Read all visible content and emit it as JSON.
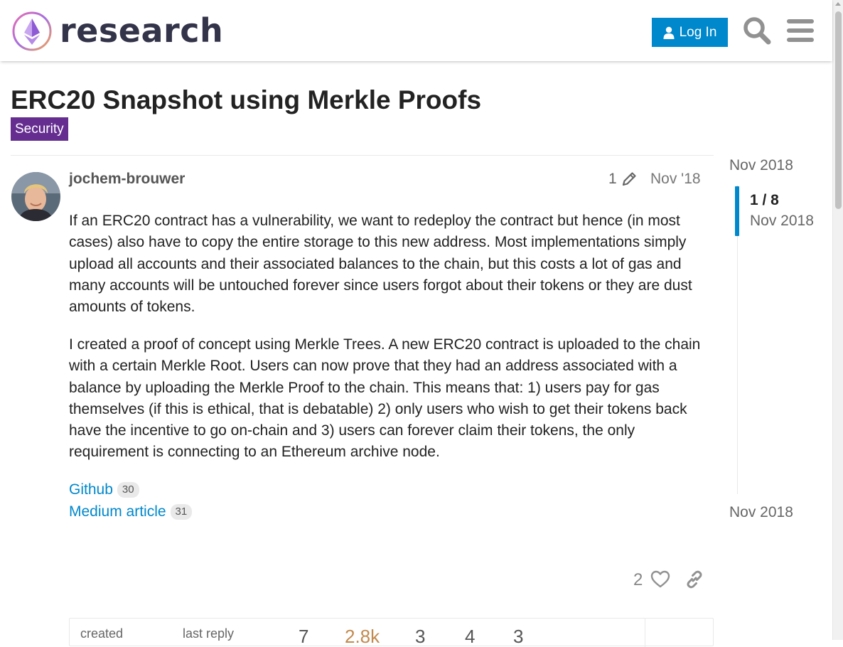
{
  "header": {
    "site_name": "research",
    "login_label": "Log In",
    "search_icon": "search-icon",
    "menu_icon": "hamburger-menu-icon",
    "brand_color": "#0088cc"
  },
  "topic": {
    "title": "ERC20 Snapshot using Merkle Proofs",
    "category": "Security",
    "category_color": "#652d90"
  },
  "post": {
    "username": "jochem-brouwer",
    "edit_count": "1",
    "date": "Nov '18",
    "paragraphs": [
      "If an ERC20 contract has a vulnerability, we want to redeploy the contract but hence (in most cases) also have to copy the entire storage to this new address. Most implementations simply upload all accounts and their associated balances to the chain, but this costs a lot of gas and many accounts will be untouched forever since users forgot about their tokens or they are dust amounts of tokens.",
      "I created a proof of concept using Merkle Trees. A new ERC20 contract is uploaded to the chain with a certain Merkle Root. Users can now prove that they had an address associated with a balance by uploading the Merkle Proof to the chain. This means that: 1) users pay for gas themselves (if this is ethical, that is debatable) 2) only users who wish to get their tokens back have the incentive to go on-chain and 3) users can forever claim their tokens, the only requirement is connecting to an Ethereum archive node."
    ],
    "links": [
      {
        "label": "Github",
        "clicks": "30"
      },
      {
        "label": "Medium article",
        "clicks": "31"
      }
    ],
    "like_count": "2"
  },
  "topic_map": {
    "created_label": "created",
    "last_reply_label": "last reply",
    "replies": "7",
    "views": "2.8k",
    "users": "3",
    "likes": "4",
    "links": "3"
  },
  "timeline": {
    "start_date": "Nov 2018",
    "position": "1 / 8",
    "position_date": "Nov 2018",
    "end_date": "Nov 2018"
  }
}
